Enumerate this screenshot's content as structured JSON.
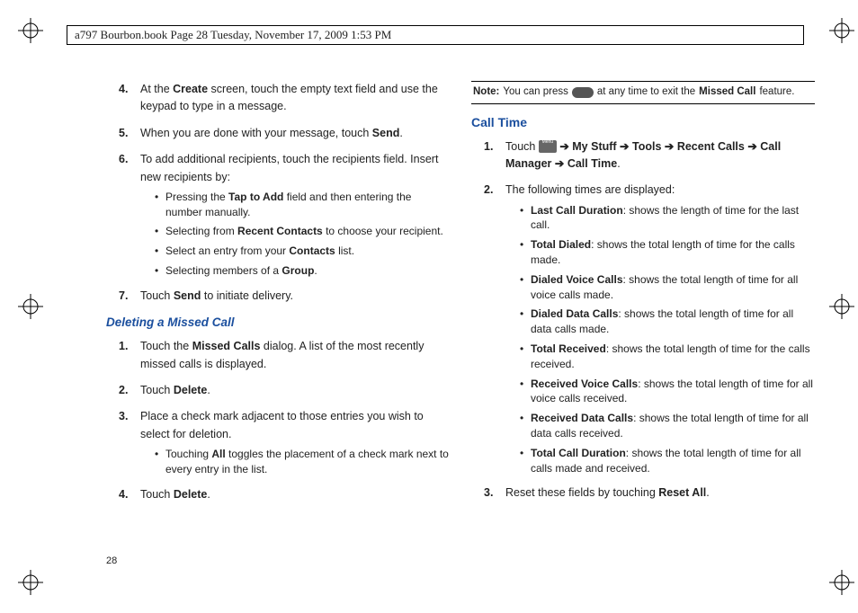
{
  "header": "a797 Bourbon.book  Page 28  Tuesday, November 17, 2009  1:53 PM",
  "pageNumber": "28",
  "left": {
    "items": [
      {
        "n": "4.",
        "pre": "At the ",
        "b1": "Create",
        "post": " screen, touch the empty text field and use the keypad to type in a message."
      },
      {
        "n": "5.",
        "pre": "When you are done with your message, touch ",
        "b1": "Send",
        "post": "."
      },
      {
        "n": "6.",
        "pre": "To add additional recipients, touch the recipients field. Insert new recipients by:",
        "bullets": [
          {
            "pre": "Pressing the ",
            "b": "Tap to Add",
            "post": " field and then entering the number manually."
          },
          {
            "pre": "Selecting from ",
            "b": "Recent Contacts",
            "post": " to choose your recipient."
          },
          {
            "pre": "Select an entry from your ",
            "b": "Contacts",
            "post": " list."
          },
          {
            "pre": "Selecting members of a ",
            "b": "Group",
            "post": "."
          }
        ]
      },
      {
        "n": "7.",
        "pre": "Touch ",
        "b1": "Send",
        "post": " to initiate delivery."
      }
    ],
    "sub": {
      "title": "Deleting a Missed Call",
      "items": [
        {
          "n": "1.",
          "pre": "Touch the ",
          "b1": "Missed Calls",
          "post": " dialog. A list of the most recently missed calls is displayed."
        },
        {
          "n": "2.",
          "pre": "Touch ",
          "b1": "Delete",
          "post": "."
        },
        {
          "n": "3.",
          "pre": "Place a check mark adjacent to those entries you wish to select for deletion.",
          "bullets": [
            {
              "pre": "Touching ",
              "b": "All",
              "post": " toggles the placement of a check mark next to every entry in the list."
            }
          ]
        },
        {
          "n": "4.",
          "pre": "Touch ",
          "b1": "Delete",
          "post": "."
        }
      ]
    }
  },
  "right": {
    "note": {
      "b1": "Note:",
      "t1": " You can press ",
      "t2": " at any time to exit the ",
      "b2": "Missed Call",
      "t3": " feature."
    },
    "title": "Call Time",
    "items": [
      {
        "n": "1.",
        "pre": "Touch ",
        "chain": [
          "My Stuff",
          "Tools",
          "Recent Calls",
          "Call Manager",
          "Call Time"
        ]
      },
      {
        "n": "2.",
        "pre": "The following times are displayed:",
        "bullets": [
          {
            "b": "Last Call Duration",
            "post": ": shows the length of time for the last call."
          },
          {
            "b": "Total Dialed",
            "post": ": shows the total length of time for the calls made."
          },
          {
            "b": "Dialed Voice Calls",
            "post": ": shows the total length of time for all voice calls made."
          },
          {
            "b": "Dialed Data Calls",
            "post": ": shows the total length of time for all data calls made."
          },
          {
            "b": "Total Received",
            "post": ": shows the total length of time for the calls received."
          },
          {
            "b": "Received Voice Calls",
            "post": ": shows the total length of time for all voice calls received."
          },
          {
            "b": "Received Data Calls",
            "post": ": shows the total length of time for all data calls received."
          },
          {
            "b": "Total Call Duration",
            "post": ": shows the total length of time for all calls made and received."
          }
        ]
      },
      {
        "n": "3.",
        "pre": "Reset these fields by touching ",
        "b1": "Reset All",
        "post": "."
      }
    ]
  }
}
